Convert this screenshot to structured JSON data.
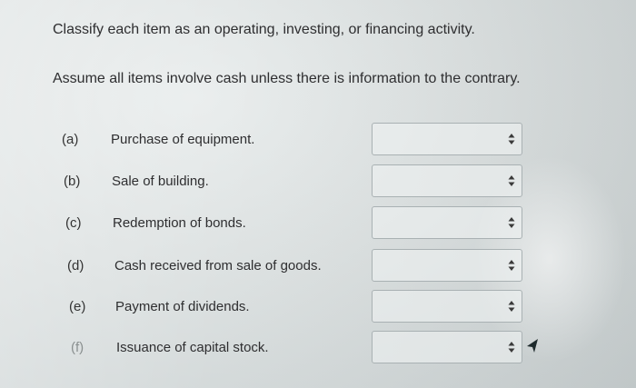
{
  "instructions": {
    "line1": "Classify each item as an operating, investing, or financing activity.",
    "line2": "Assume all items involve cash unless there is information to the contrary."
  },
  "items": [
    {
      "letter": "(a)",
      "description": "Purchase of equipment.",
      "selected": ""
    },
    {
      "letter": "(b)",
      "description": "Sale of building.",
      "selected": ""
    },
    {
      "letter": "(c)",
      "description": "Redemption of bonds.",
      "selected": ""
    },
    {
      "letter": "(d)",
      "description": "Cash received from sale of goods.",
      "selected": ""
    },
    {
      "letter": "(e)",
      "description": "Payment of dividends.",
      "selected": ""
    },
    {
      "letter": "(f)",
      "description": "Issuance of capital stock.",
      "selected": ""
    }
  ],
  "icons": {
    "select_arrows": "up-down-arrows-icon",
    "cursor": "mouse-pointer-icon"
  },
  "colors": {
    "background": "#dadfdf",
    "text": "#2e2e30",
    "select_border": "#a9b1b3"
  }
}
